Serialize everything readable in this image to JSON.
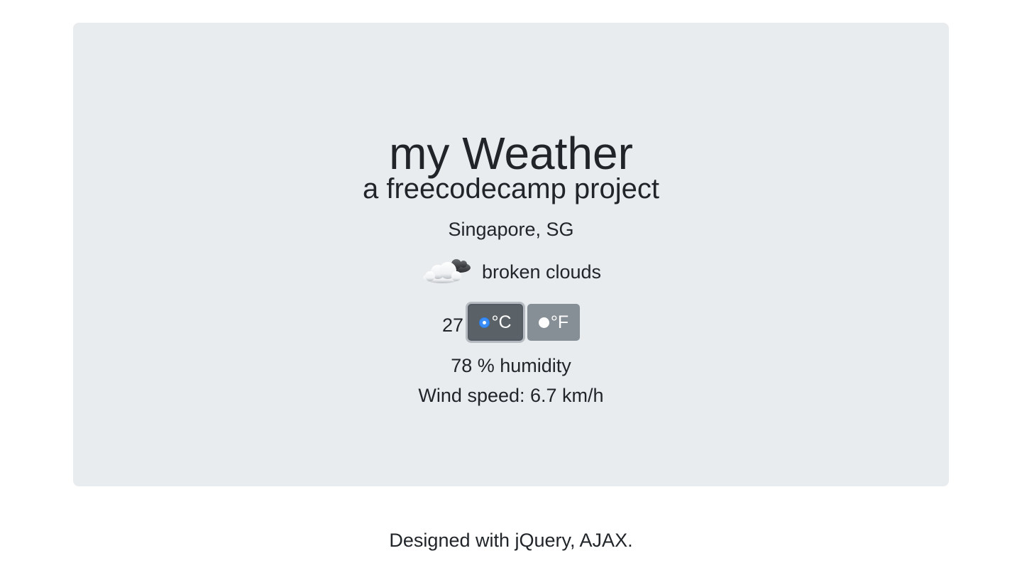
{
  "header": {
    "title": "my Weather",
    "subtitle": "a freecodecamp project"
  },
  "weather": {
    "location": "Singapore, SG",
    "icon": "broken-clouds-icon",
    "description": "broken clouds",
    "temperature": "27",
    "units": [
      {
        "label": "°C",
        "selected": true
      },
      {
        "label": "°F",
        "selected": false
      }
    ],
    "humidity": "78 % humidity",
    "wind": "Wind speed: 6.7 km/h"
  },
  "footer": {
    "text": "Designed with jQuery, AJAX."
  },
  "colors": {
    "panel_bg": "#e9ecef",
    "text": "#212529",
    "button_active": "#5a6268",
    "button": "#868e96",
    "radio_checked": "#3b8ef7"
  }
}
